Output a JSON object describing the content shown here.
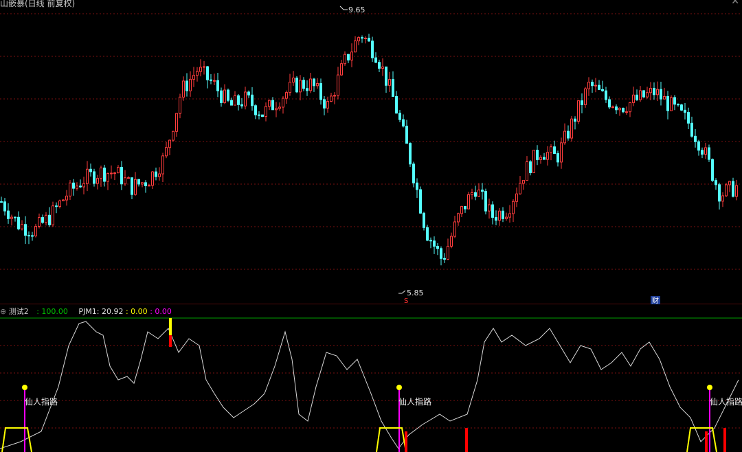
{
  "header": {
    "title": "山嵌暴(日线 前复权)"
  },
  "colors": {
    "up": "#ff3d3d",
    "down": "#54ffff",
    "grid": "#7a1010",
    "osc": "#d8d8d8",
    "yellow": "#ffff00",
    "magenta": "#ff00ff",
    "red": "#ff0000",
    "green": "#00c000"
  },
  "main": {
    "high_label": "9.65",
    "low_label": "5.85",
    "marker_s": "S",
    "marker_cai": "财"
  },
  "indicator": {
    "name": "测试2",
    "v1": ": 100.00",
    "pjm_label": "PJM1: 20.92",
    "v2": ": 0.00",
    "v3": ": 0.00",
    "signal_text": "仙人指路"
  },
  "chart_data": {
    "type": "candlestick",
    "ylim": [
      5.6,
      9.75
    ],
    "high": 9.65,
    "low": 5.85,
    "trend": [
      7.0,
      6.7,
      6.6,
      6.8,
      7.1,
      7.3,
      7.4,
      7.4,
      7.2,
      7.3,
      7.6,
      8.5,
      8.8,
      8.6,
      8.3,
      8.4,
      8.2,
      8.4,
      8.6,
      8.6,
      8.3,
      8.9,
      9.3,
      9.0,
      8.4,
      7.6,
      6.6,
      6.2,
      6.8,
      7.2,
      6.8,
      6.9,
      7.4,
      7.7,
      7.6,
      8.1,
      8.6,
      8.4,
      8.3,
      8.4,
      8.5,
      8.3,
      8.1,
      7.7,
      7.1,
      7.2
    ]
  }
}
